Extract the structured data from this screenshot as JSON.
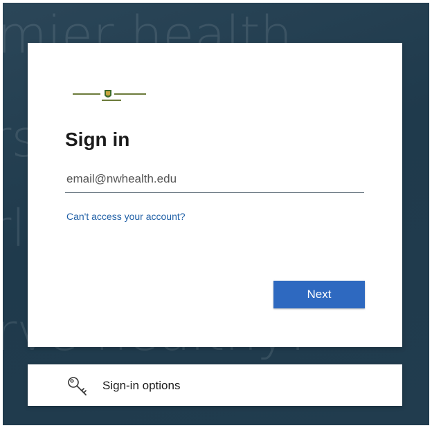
{
  "background": {
    "lines": [
      "mier health",
      "rs",
      "rl",
      "rve healthy!"
    ]
  },
  "signin": {
    "logo_name": "university-logo",
    "title": "Sign in",
    "email_placeholder": "email@nwhealth.edu",
    "cant_access_link": "Can't access your account?",
    "next_button": "Next"
  },
  "options": {
    "label": "Sign-in options",
    "icon": "key-icon"
  },
  "colors": {
    "accent": "#2e69c0",
    "link": "#1f5fa6",
    "background": "#213c4e"
  }
}
